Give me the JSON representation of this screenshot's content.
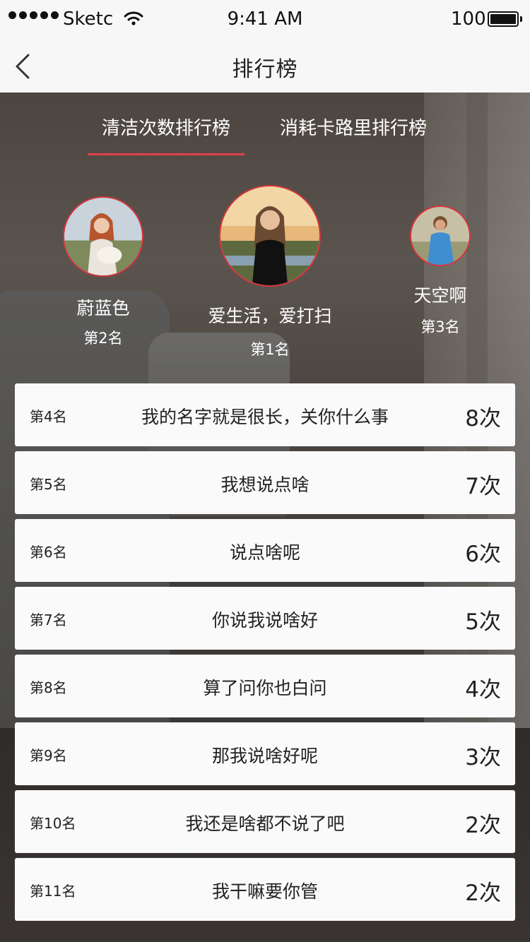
{
  "status_bar": {
    "carrier": "Sketc",
    "time": "9:41 AM",
    "battery": "100"
  },
  "nav": {
    "title": "排行榜"
  },
  "tabs": [
    {
      "label": "清洁次数排行榜",
      "active": true
    },
    {
      "label": "消耗卡路里排行榜",
      "active": false
    }
  ],
  "podium": {
    "first": {
      "name": "爱生活，爱打扫",
      "rank": "第1名"
    },
    "second": {
      "name": "蔚蓝色",
      "rank": "第2名"
    },
    "third": {
      "name": "天空啊",
      "rank": "第3名"
    }
  },
  "ranking": [
    {
      "rank": "第4名",
      "name": "我的名字就是很长，关你什么事",
      "count": "8次"
    },
    {
      "rank": "第5名",
      "name": "我想说点啥",
      "count": "7次"
    },
    {
      "rank": "第6名",
      "name": "说点啥呢",
      "count": "6次"
    },
    {
      "rank": "第7名",
      "name": "你说我说啥好",
      "count": "5次"
    },
    {
      "rank": "第8名",
      "name": "算了问你也白问",
      "count": "4次"
    },
    {
      "rank": "第9名",
      "name": "那我说啥好呢",
      "count": "3次"
    },
    {
      "rank": "第10名",
      "name": "我还是啥都不说了吧",
      "count": "2次"
    },
    {
      "rank": "第11名",
      "name": "我干嘛要你管",
      "count": "2次"
    }
  ],
  "colors": {
    "accent": "#e0424a",
    "avatar_ring": "#d8333d",
    "row_bg": "#fafafa"
  }
}
